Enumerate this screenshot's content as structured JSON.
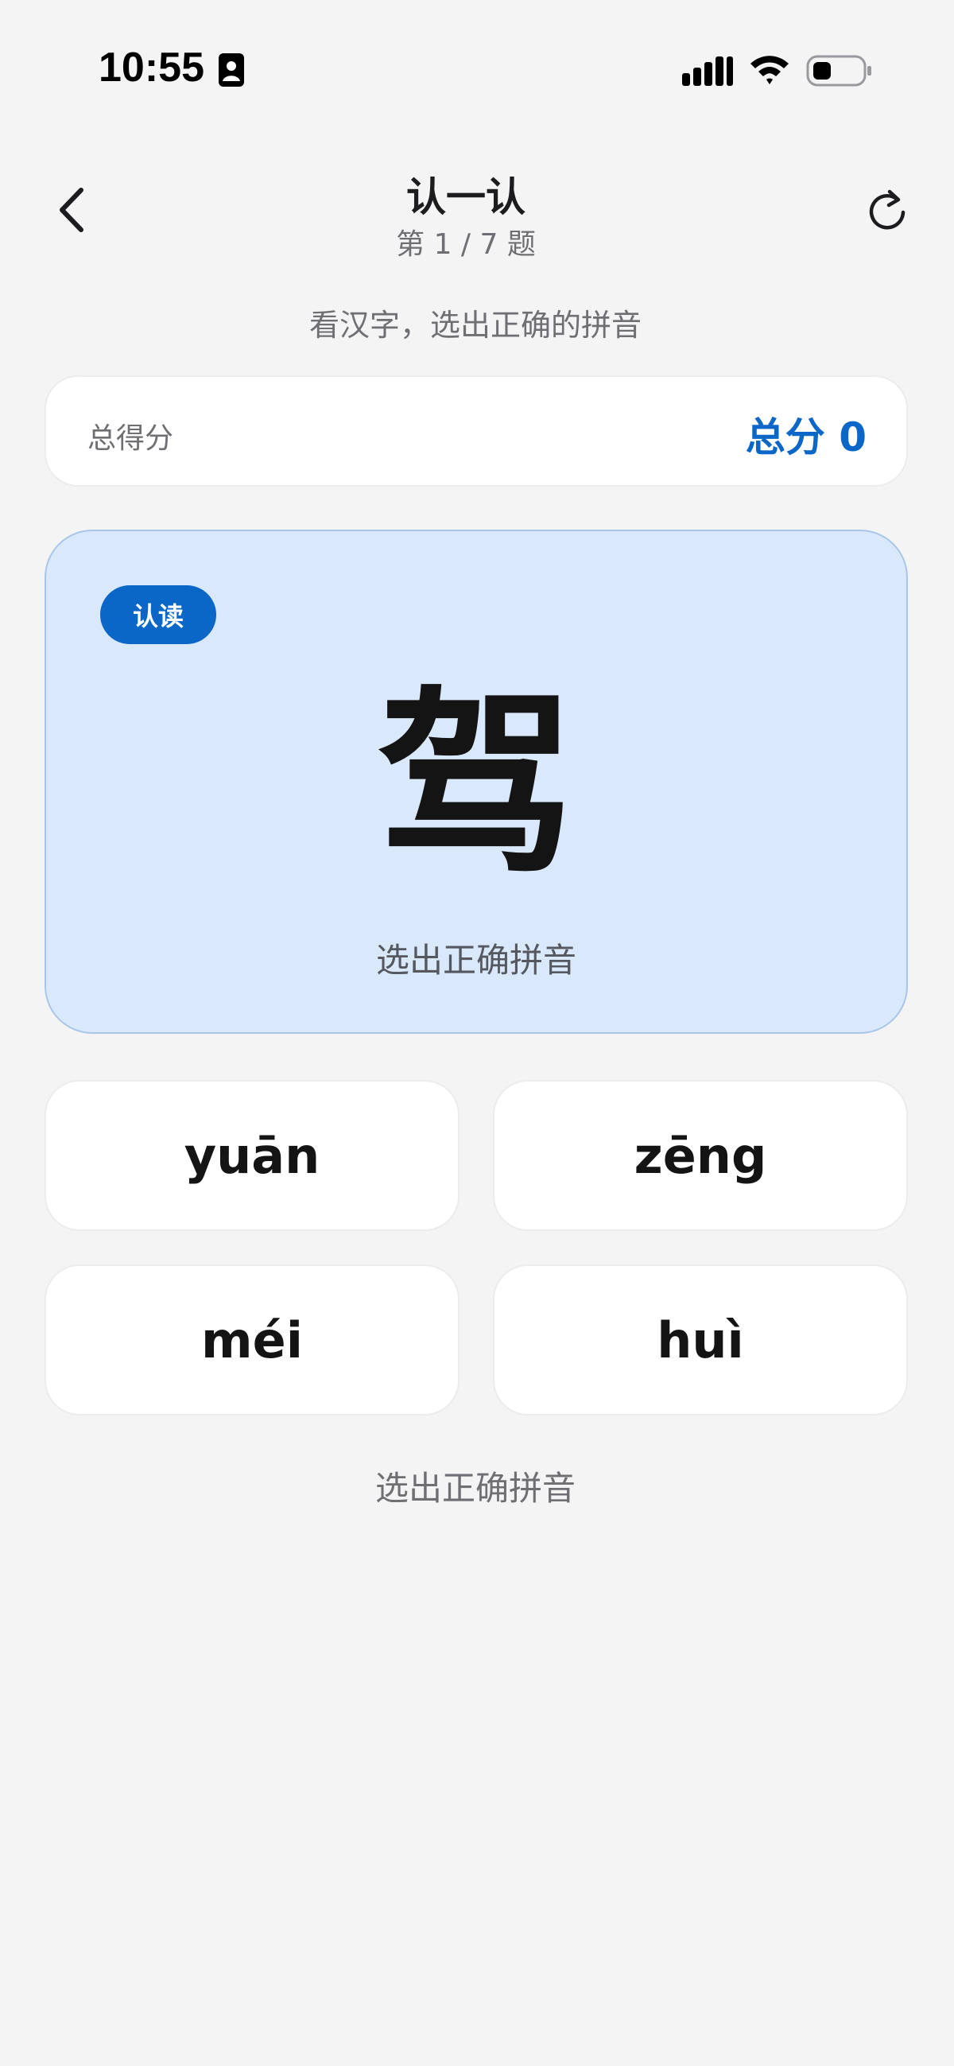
{
  "status_bar": {
    "time": "10:55",
    "icons": [
      "id-card-icon",
      "signal-icon",
      "wifi-icon",
      "battery-icon"
    ]
  },
  "header": {
    "title": "认一认",
    "progress": "第 1 / 7 题",
    "back_icon": "chevron-left-icon",
    "refresh_icon": "refresh-icon"
  },
  "instruction": "看汉字，选出正确的拼音",
  "score": {
    "label": "总得分",
    "value": "总分 0"
  },
  "question": {
    "badge": "认读",
    "character": "驾",
    "hint": "选出正确拼音"
  },
  "options": [
    {
      "label": "yuān"
    },
    {
      "label": "zēng"
    },
    {
      "label": "méi"
    },
    {
      "label": "huì"
    }
  ],
  "footer_hint": "选出正确拼音",
  "colors": {
    "accent": "#0a67c8",
    "card_background": "#d9e8fb",
    "page_background": "#f4f4f5"
  }
}
